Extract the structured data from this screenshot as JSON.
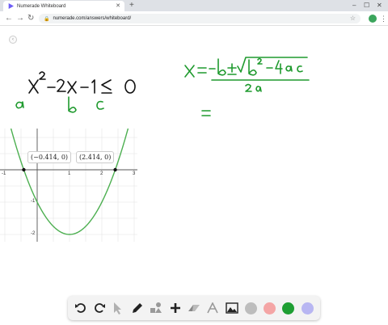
{
  "browser": {
    "tab_title": "Numerade Whiteboard",
    "new_tab_glyph": "+",
    "url": "numerade.com/answers/whiteboard/"
  },
  "graph": {
    "points": [
      {
        "label": "(−0.414, 0)",
        "x": -0.414,
        "y": 0
      },
      {
        "label": "(2.414, 0)",
        "x": 2.414,
        "y": 0
      }
    ],
    "x_ticks": [
      "-1",
      "1",
      "2",
      "3"
    ],
    "y_ticks": [
      "-1",
      "-2"
    ],
    "curve_color": "#4caf50"
  },
  "ink_color": "#1f9a2e",
  "tools": {
    "colors": [
      "#bdbdbd",
      "#f4a5a5",
      "#1e9e33",
      "#b8b6f2"
    ],
    "active_color": "#1e9e33"
  }
}
